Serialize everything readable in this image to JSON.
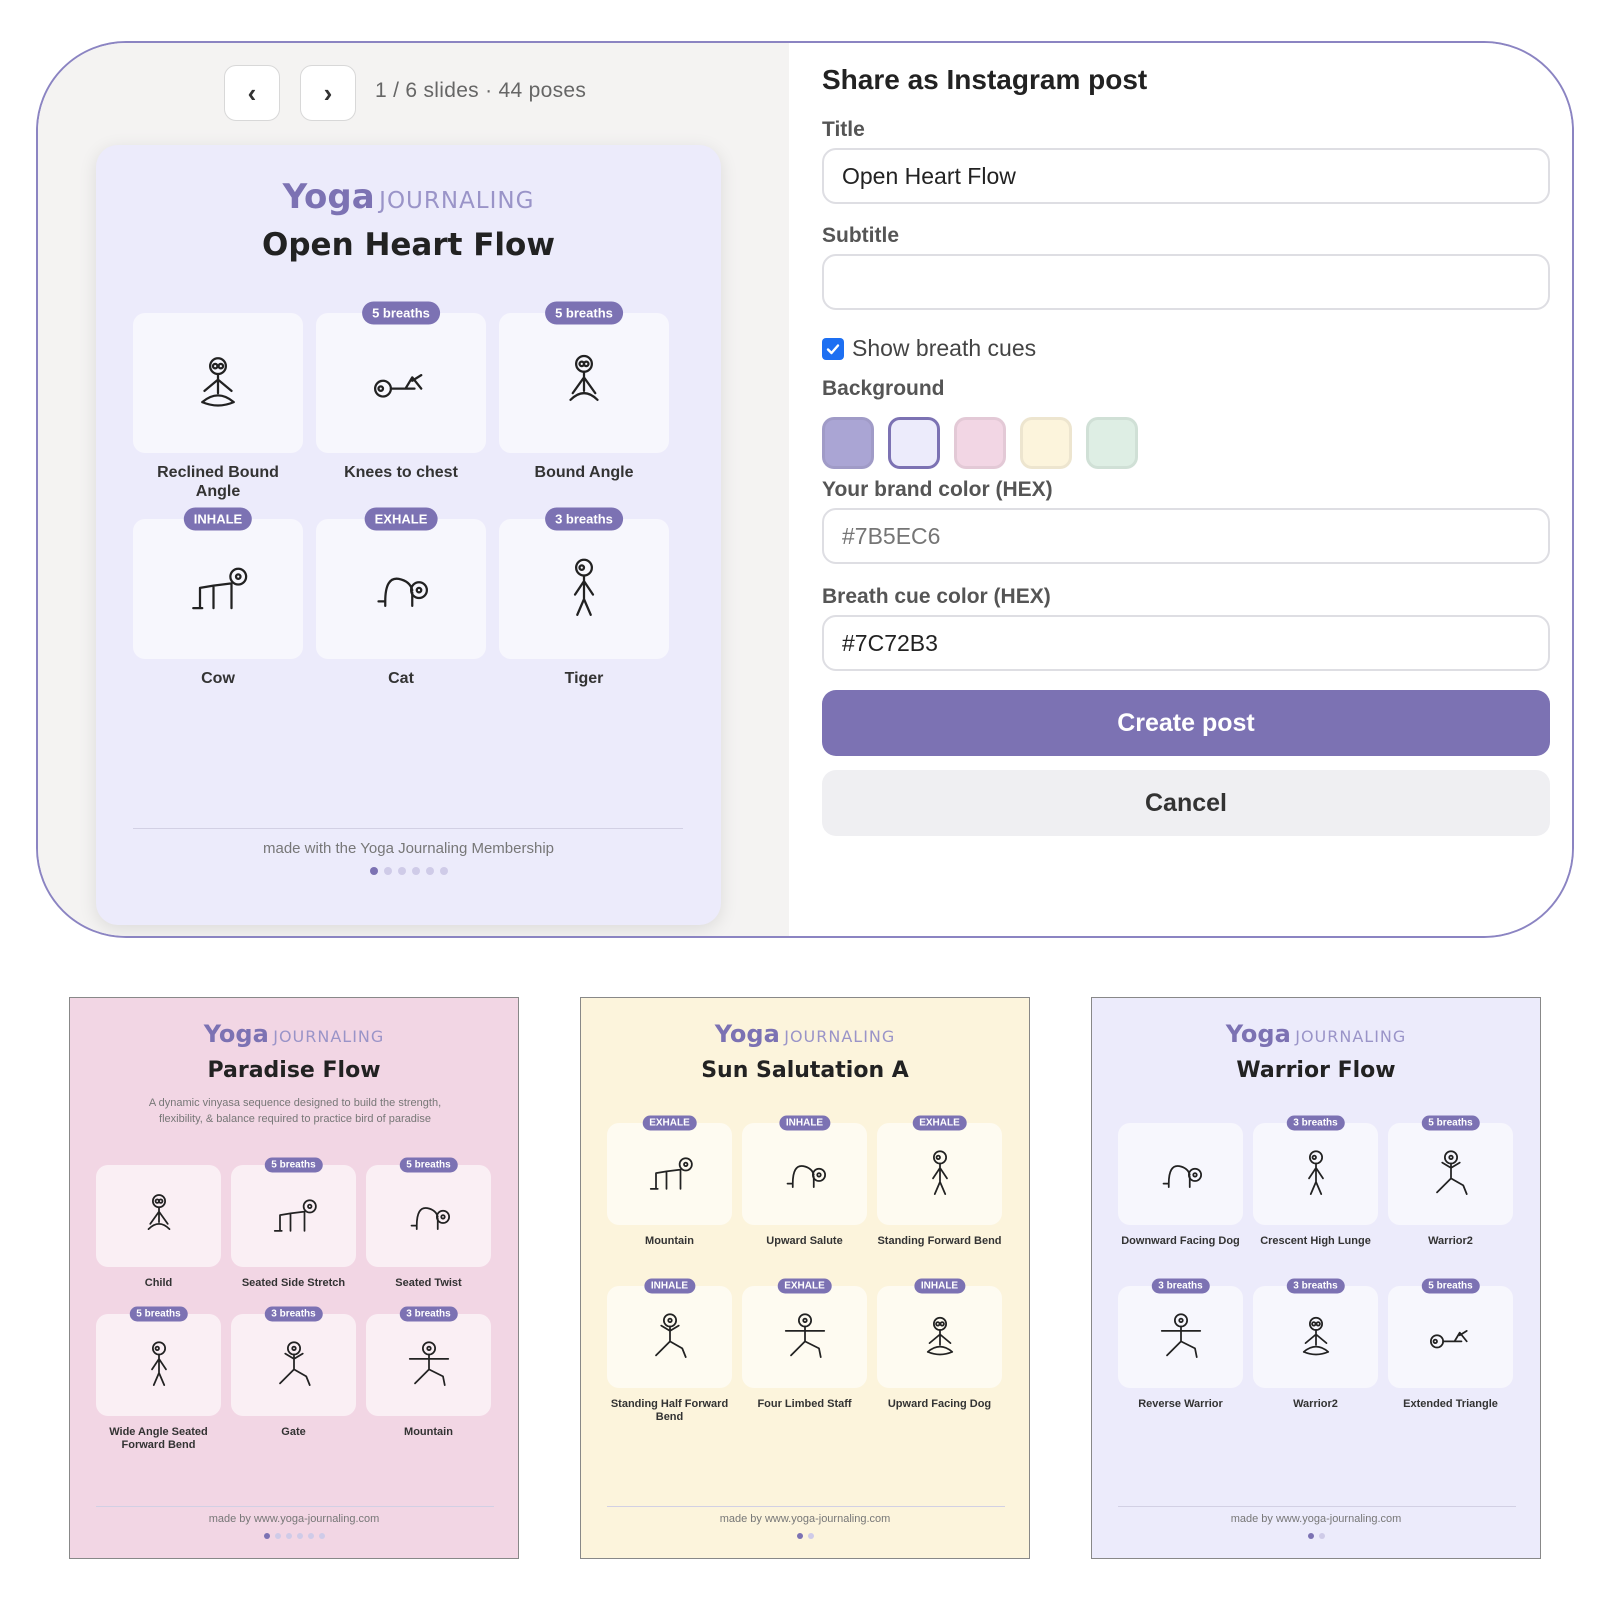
{
  "editor": {
    "nav": {
      "prev": "‹",
      "next": "›"
    },
    "slide_status": "1 / 6 slides · 44 poses",
    "preview": {
      "brand_a": "Yoga",
      "brand_b": "JOURNALING",
      "title": "Open Heart Flow",
      "poses": [
        {
          "label": "Reclined Bound Angle",
          "cue": "",
          "icon": "reclined-bound-angle-figure"
        },
        {
          "label": "Knees to chest",
          "cue": "5 breaths",
          "icon": "knees-to-chest-figure"
        },
        {
          "label": "Bound Angle",
          "cue": "5 breaths",
          "icon": "bound-angle-figure"
        },
        {
          "label": "Cow",
          "cue": "INHALE",
          "icon": "cow-figure"
        },
        {
          "label": "Cat",
          "cue": "EXHALE",
          "icon": "cat-figure"
        },
        {
          "label": "Tiger",
          "cue": "3 breaths",
          "icon": "tiger-figure"
        }
      ],
      "footer": "made with the Yoga Journaling Membership",
      "dots_total": 6,
      "dots_active": 1
    },
    "form": {
      "heading": "Share as Instagram post",
      "title_label": "Title",
      "title_value": "Open Heart Flow",
      "subtitle_label": "Subtitle",
      "subtitle_value": "",
      "breath_cue_toggle": "Show breath cues",
      "breath_cue_checked": true,
      "background_label": "Background",
      "background_options": [
        "#aaa5d4",
        "#ecebfb",
        "#f2d6e4",
        "#fcf4dc",
        "#deeee4"
      ],
      "background_selected": 1,
      "brand_label": "Your brand color (HEX)",
      "brand_placeholder": "#7B5EC6",
      "cue_color_label": "Breath cue color (HEX)",
      "cue_color_value": "#7C72B3",
      "create_label": "Create post",
      "cancel_label": "Cancel"
    }
  },
  "samples": [
    {
      "bg": "#f2d6e4",
      "brand_a": "Yoga",
      "brand_b": "JOURNALING",
      "title": "Paradise Flow",
      "subtitle": "A dynamic vinyasa sequence designed to build the strength, flexibility, & balance required to practice bird of paradise",
      "poses": [
        {
          "label": "Child",
          "cue": ""
        },
        {
          "label": "Seated Side Stretch",
          "cue": "5 breaths"
        },
        {
          "label": "Seated Twist",
          "cue": "5 breaths"
        },
        {
          "label": "Wide Angle Seated Forward Bend",
          "cue": "5 breaths"
        },
        {
          "label": "Gate",
          "cue": "3 breaths"
        },
        {
          "label": "Mountain",
          "cue": "3 breaths"
        }
      ],
      "footer": "made by www.yoga-journaling.com",
      "dots_total": 6
    },
    {
      "bg": "#fcf4dc",
      "brand_a": "Yoga",
      "brand_b": "JOURNALING",
      "title": "Sun Salutation A",
      "subtitle": "",
      "poses": [
        {
          "label": "Mountain",
          "cue": "EXHALE"
        },
        {
          "label": "Upward Salute",
          "cue": "INHALE"
        },
        {
          "label": "Standing Forward Bend",
          "cue": "EXHALE"
        },
        {
          "label": "Standing Half Forward Bend",
          "cue": "INHALE"
        },
        {
          "label": "Four Limbed Staff",
          "cue": "EXHALE"
        },
        {
          "label": "Upward Facing Dog",
          "cue": "INHALE"
        }
      ],
      "footer": "made by www.yoga-journaling.com",
      "dots_total": 2
    },
    {
      "bg": "#ecebfb",
      "brand_a": "Yoga",
      "brand_b": "JOURNALING",
      "title": "Warrior Flow",
      "subtitle": "",
      "poses": [
        {
          "label": "Downward Facing Dog",
          "cue": ""
        },
        {
          "label": "Crescent High Lunge",
          "cue": "3 breaths"
        },
        {
          "label": "Warrior2",
          "cue": "5 breaths"
        },
        {
          "label": "Reverse Warrior",
          "cue": "3 breaths"
        },
        {
          "label": "Warrior2",
          "cue": "3 breaths"
        },
        {
          "label": "Extended Triangle",
          "cue": "5 breaths"
        }
      ],
      "footer": "made by www.yoga-journaling.com",
      "dots_total": 2
    }
  ]
}
